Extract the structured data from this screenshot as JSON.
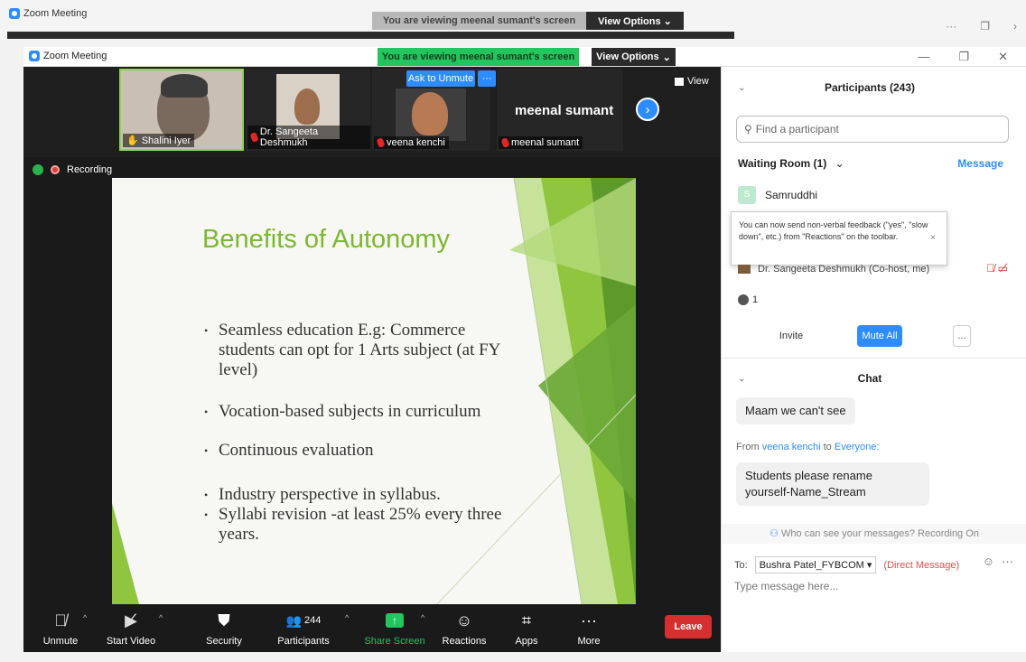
{
  "outer": {
    "title": "Zoom Meeting",
    "banner": "You are viewing meenal sumant's screen",
    "view_options": "View Options ⌄",
    "ctrl_more": "···",
    "ctrl_restore": "❐",
    "ctrl_close": "›"
  },
  "window": {
    "title": "Zoom Meeting",
    "banner": "You are viewing meenal sumant's screen",
    "view_options": "View Options",
    "min": "—",
    "restore": "❐",
    "close": "✕"
  },
  "video_strip": {
    "tiles": [
      {
        "name": "Shalini Iyer"
      },
      {
        "name": "Dr. Sangeeta Deshmukh"
      },
      {
        "name": "veena kenchi"
      },
      {
        "name": "meenal sumant"
      }
    ],
    "ask_to_unmute": "Ask to Unmute",
    "more": "···",
    "big_name": "meenal sumant",
    "view": "View"
  },
  "recording": "Recording",
  "slide": {
    "title": "Benefits of Autonomy",
    "bullets": [
      "Seamless education E.g: Commerce students can opt for 1 Arts subject (at FY level)",
      "Vocation-based subjects in curriculum",
      "Continuous evaluation",
      " Industry perspective in syllabus.",
      "Syllabi revision -at least 25% every three years."
    ]
  },
  "toolbar": {
    "unmute": "Unmute",
    "start_video": "Start Video",
    "security": "Security",
    "participants": "Participants",
    "participants_count": "244",
    "share_screen": "Share Screen",
    "reactions": "Reactions",
    "apps": "Apps",
    "more": "More",
    "leave": "Leave"
  },
  "panel": {
    "title": "Participants (243)",
    "search_placeholder": "Find a participant",
    "waiting_room": "Waiting Room (1)",
    "message": "Message",
    "waiting_user": "Samruddhi",
    "waiting_avatar": "S",
    "tooltip": "You can now send non-verbal feedback (\"yes\", \"slow down\", etc.) from \"Reactions\" on the toolbar.",
    "tooltip_close": "×",
    "host_row": "Dr. Sangeeta Deshmukh (Co-host, me)",
    "raised_count": "1",
    "invite": "Invite",
    "mute_all": "Mute All",
    "more": "...",
    "chat_title": "Chat",
    "msg1": "Maam we can't see",
    "from_label": "From",
    "from_name": "veena kenchi",
    "to_label": "to",
    "to_name": "Everyone:",
    "msg2": "Students please rename yourself-Name_Stream",
    "who_can_see": "Who can see your messages? Recording On",
    "to": "To:",
    "to_value": "Bushra Patel_FYBCOM ▾",
    "direct": "(Direct Message)",
    "type_placeholder": "Type message here..."
  }
}
